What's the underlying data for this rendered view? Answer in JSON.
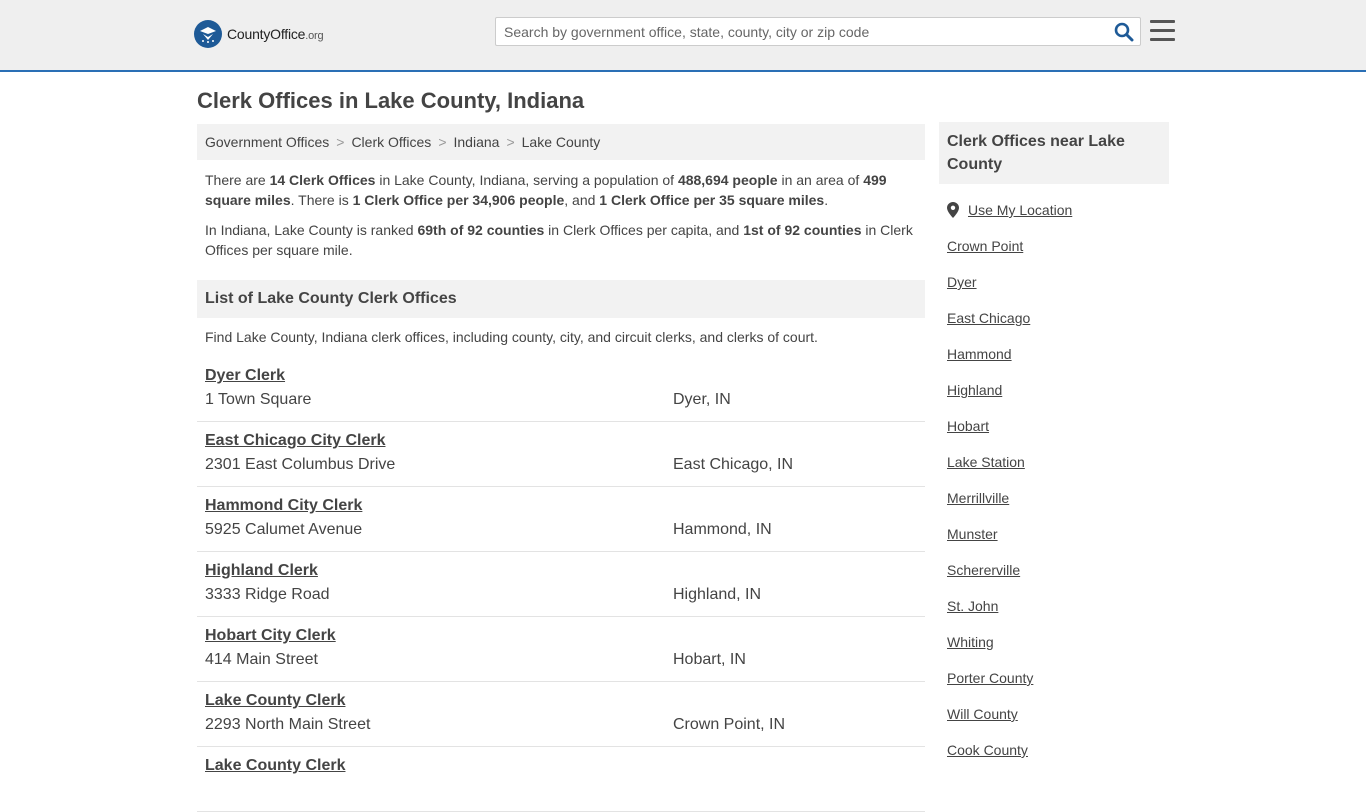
{
  "header": {
    "logo_main": "CountyOffice",
    "logo_suffix": ".org",
    "search_placeholder": "Search by government office, state, county, city or zip code"
  },
  "page_title": "Clerk Offices in Lake County, Indiana",
  "breadcrumb": [
    "Government Offices",
    "Clerk Offices",
    "Indiana",
    "Lake County"
  ],
  "intro": {
    "p1": {
      "t1": "There are ",
      "b1": "14 Clerk Offices",
      "t2": " in Lake County, Indiana, serving a population of ",
      "b2": "488,694 people",
      "t3": " in an area of ",
      "b3": "499 square miles",
      "t4": ". There is ",
      "b4": "1 Clerk Office per 34,906 people",
      "t5": ", and ",
      "b5": "1 Clerk Office per 35 square miles",
      "t6": "."
    },
    "p2": {
      "t1": "In Indiana, Lake County is ranked ",
      "b1": "69th of 92 counties",
      "t2": " in Clerk Offices per capita, and ",
      "b2": "1st of 92 counties",
      "t3": " in Clerk Offices per square mile."
    }
  },
  "list": {
    "heading": "List of Lake County Clerk Offices",
    "description": "Find Lake County, Indiana clerk offices, including county, city, and circuit clerks, and clerks of court.",
    "offices": [
      {
        "name": "Dyer Clerk",
        "address": "1 Town Square",
        "city": "Dyer, IN"
      },
      {
        "name": "East Chicago City Clerk",
        "address": "2301 East Columbus Drive",
        "city": "East Chicago, IN"
      },
      {
        "name": "Hammond City Clerk",
        "address": "5925 Calumet Avenue",
        "city": "Hammond, IN"
      },
      {
        "name": "Highland Clerk",
        "address": "3333 Ridge Road",
        "city": "Highland, IN"
      },
      {
        "name": "Hobart City Clerk",
        "address": "414 Main Street",
        "city": "Hobart, IN"
      },
      {
        "name": "Lake County Clerk",
        "address": "2293 North Main Street",
        "city": "Crown Point, IN"
      },
      {
        "name": "Lake County Clerk",
        "address": "",
        "city": ""
      }
    ]
  },
  "sidebar": {
    "heading": "Clerk Offices near Lake County",
    "use_location": "Use My Location",
    "links": [
      "Crown Point",
      "Dyer",
      "East Chicago",
      "Hammond",
      "Highland",
      "Hobart",
      "Lake Station",
      "Merrillville",
      "Munster",
      "Schererville",
      "St. John",
      "Whiting",
      "Porter County",
      "Will County",
      "Cook County"
    ]
  },
  "colors": {
    "brand_blue": "#1e5a97",
    "header_bg": "#efefef",
    "panel_bg": "#f2f2f2",
    "text": "#444444"
  },
  "icons": [
    "logo-seal-icon",
    "search-icon",
    "hamburger-menu-icon",
    "map-pin-icon"
  ]
}
